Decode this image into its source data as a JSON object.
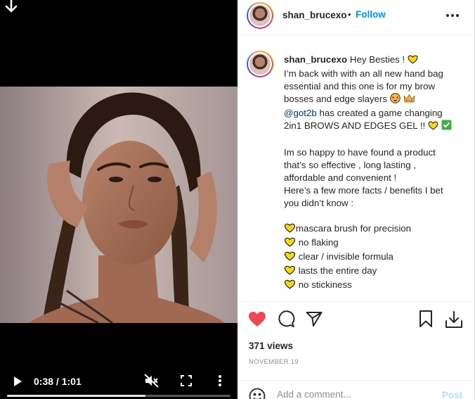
{
  "video": {
    "current_time": "0:38",
    "separator": "/",
    "duration": "1:01",
    "progress": 0.62,
    "icons": [
      "down-arrow-icon",
      "play-icon",
      "muted-icon",
      "fullscreen-icon",
      "more-vertical-icon"
    ]
  },
  "header": {
    "username": "shan_brucexo",
    "dot": "•",
    "follow_label": "Follow"
  },
  "caption": {
    "username": "shan_brucexo",
    "first_text": "Hey Besties !",
    "lines": [
      "I’m back with with an all new hand bag",
      "essential and this one is for my brow",
      "bosses and edge slayers"
    ],
    "mention": "@got2b",
    "mention_rest": "has created a game changing",
    "line_gel": "2in1 BROWS AND EDGES GEL !!",
    "paragraph2": [
      "Im so happy to have found a product",
      "that’s so effective , long lasting ,",
      "affordable and convenient !",
      "Here’s a few more facts / benefits I bet",
      "you didn’t know :"
    ],
    "benefits": [
      "mascara brush for precision",
      "no flaking",
      "clear / invisible formula",
      "lasts the entire day",
      "no stickiness"
    ]
  },
  "stats": {
    "views": "371 views",
    "date": "NOVEMBER 19"
  },
  "comment": {
    "placeholder": "Add a comment...",
    "post_label": "Post"
  },
  "colors": {
    "accent_blue": "#0095f6",
    "like_red": "#ed4956",
    "heart_yellow": "#f8d90f"
  }
}
